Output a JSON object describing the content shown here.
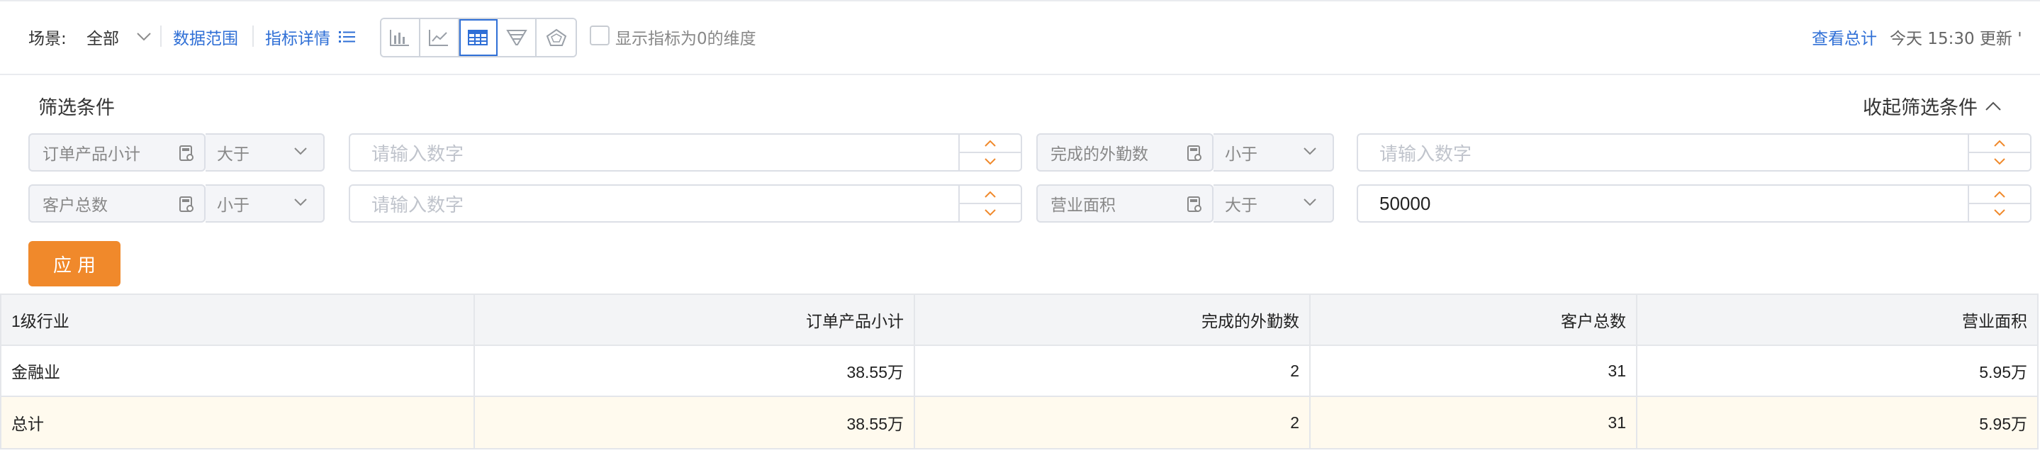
{
  "toolbar": {
    "scene_label": "场景:",
    "scene_value": "全部",
    "data_range_link": "数据范围",
    "indicator_detail_link": "指标详情",
    "chart_types": [
      "bar-chart-icon",
      "line-chart-icon",
      "table-icon",
      "funnel-icon",
      "radar-icon"
    ],
    "active_chart_type": "table-icon",
    "show_zero_label": "显示指标为0的维度",
    "show_zero_checked": false,
    "view_total_link": "查看总计",
    "update_text": "今天 15:30 更新 '"
  },
  "filters": {
    "title": "筛选条件",
    "collapse_label": "收起筛选条件",
    "rows": [
      {
        "field": "订单产品小计",
        "operator": "大于",
        "placeholder": "请输入数字",
        "value": ""
      },
      {
        "field": "完成的外勤数",
        "operator": "小于",
        "placeholder": "请输入数字",
        "value": ""
      },
      {
        "field": "客户总数",
        "operator": "小于",
        "placeholder": "请输入数字",
        "value": ""
      },
      {
        "field": "营业面积",
        "operator": "大于",
        "placeholder": "请输入数字",
        "value": "50000"
      }
    ],
    "apply_label": "应用"
  },
  "table": {
    "columns": [
      "1级行业",
      "订单产品小计",
      "完成的外勤数",
      "客户总数",
      "营业面积"
    ],
    "rows": [
      [
        "金融业",
        "38.55万",
        "2",
        "31",
        "5.95万"
      ]
    ],
    "total_row": [
      "总计",
      "38.55万",
      "2",
      "31",
      "5.95万"
    ]
  },
  "colors": {
    "link": "#2f6fd6",
    "apply_button": "#f0892b",
    "total_row_bg": "#fffaee",
    "header_bg": "#f3f4f6"
  }
}
